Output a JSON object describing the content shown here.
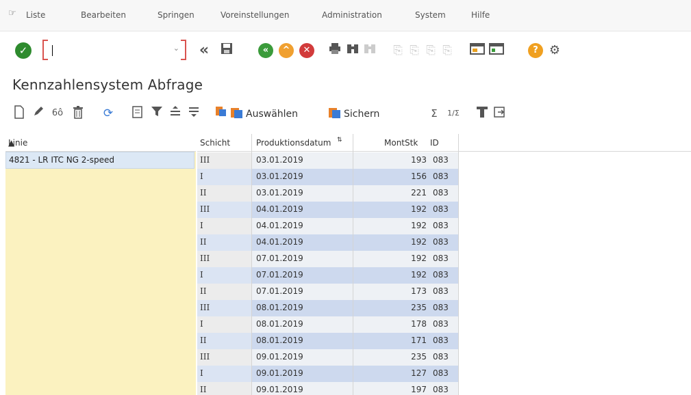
{
  "menubar": {
    "items": [
      "Liste",
      "Bearbeiten",
      "Springen",
      "Voreinstellungen",
      "Administration",
      "System",
      "Hilfe"
    ]
  },
  "command_field": {
    "value": ""
  },
  "title": "Kennzahlensystem Abfrage",
  "toolbar": {
    "select_label": "Auswählen",
    "save_label": "Sichern",
    "sigma": "Σ",
    "fraction": "1/Σ"
  },
  "grid": {
    "left_header": "Linie",
    "left_value": "4821 - LR ITC NG 2-speed",
    "columns": [
      "Schicht",
      "Produktionsdatum",
      "MontStk",
      "ID"
    ],
    "rows": [
      [
        "III",
        "03.01.2019",
        "193",
        "083"
      ],
      [
        "I",
        "03.01.2019",
        "156",
        "083"
      ],
      [
        "II",
        "03.01.2019",
        "221",
        "083"
      ],
      [
        "III",
        "04.01.2019",
        "192",
        "083"
      ],
      [
        "I",
        "04.01.2019",
        "192",
        "083"
      ],
      [
        "II",
        "04.01.2019",
        "192",
        "083"
      ],
      [
        "III",
        "07.01.2019",
        "192",
        "083"
      ],
      [
        "I",
        "07.01.2019",
        "192",
        "083"
      ],
      [
        "II",
        "07.01.2019",
        "173",
        "083"
      ],
      [
        "III",
        "08.01.2019",
        "235",
        "083"
      ],
      [
        "I",
        "08.01.2019",
        "178",
        "083"
      ],
      [
        "II",
        "08.01.2019",
        "171",
        "083"
      ],
      [
        "III",
        "09.01.2019",
        "235",
        "083"
      ],
      [
        "I",
        "09.01.2019",
        "127",
        "083"
      ],
      [
        "II",
        "09.01.2019",
        "197",
        "083"
      ]
    ]
  },
  "colors": {
    "ok_green": "#2e8b2e",
    "nav_green": "#3b9b3b",
    "nav_orange": "#f0a030",
    "cancel_red": "#d23b3b",
    "help_orange": "#f0a020",
    "left_pane": "#fbf2c0",
    "row_highlight": "#cdd9ee"
  },
  "icons": [
    "menu-icon",
    "ok-icon",
    "back-double-icon",
    "save-icon",
    "back-icon",
    "exit-icon",
    "cancel-icon",
    "print-icon",
    "find-icon",
    "find-next-icon",
    "first-page-icon",
    "prev-page-icon",
    "next-page-icon",
    "last-page-icon",
    "new-session-icon",
    "shortcut-icon",
    "help-icon",
    "settings-icon",
    "create-icon",
    "edit-icon",
    "display-icon",
    "delete-icon",
    "refresh-icon",
    "details-icon",
    "filter-icon",
    "sort-asc-icon",
    "sort-desc-icon",
    "layout-icon",
    "layout-select-icon",
    "layout-save-icon",
    "sum-icon",
    "subtotal-icon",
    "export-icon",
    "print-preview-icon"
  ]
}
